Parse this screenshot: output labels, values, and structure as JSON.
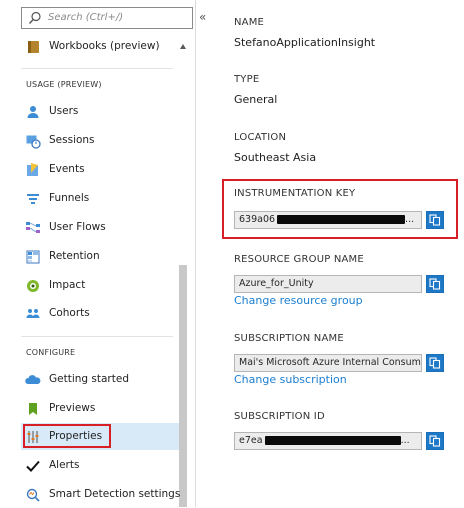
{
  "sidebar": {
    "search_placeholder": "Search (Ctrl+/)",
    "collapse_icon": "«",
    "sections": {
      "usage": "USAGE (PREVIEW)",
      "configure": "CONFIGURE"
    },
    "items": [
      {
        "label": "Workbooks (preview)",
        "icon": "workbook-icon"
      },
      {
        "label": "Users",
        "icon": "user-icon"
      },
      {
        "label": "Sessions",
        "icon": "sessions-icon"
      },
      {
        "label": "Events",
        "icon": "events-icon"
      },
      {
        "label": "Funnels",
        "icon": "funnel-icon"
      },
      {
        "label": "User Flows",
        "icon": "user-flows-icon"
      },
      {
        "label": "Retention",
        "icon": "retention-icon"
      },
      {
        "label": "Impact",
        "icon": "impact-icon"
      },
      {
        "label": "Cohorts",
        "icon": "cohorts-icon"
      },
      {
        "label": "Getting started",
        "icon": "cloud-icon"
      },
      {
        "label": "Previews",
        "icon": "bookmark-icon"
      },
      {
        "label": "Properties",
        "icon": "properties-icon"
      },
      {
        "label": "Alerts",
        "icon": "checkmark-icon"
      },
      {
        "label": "Smart Detection settings",
        "icon": "smart-detection-icon"
      }
    ],
    "selected": "Properties"
  },
  "properties": {
    "name_label": "NAME",
    "name_value": "StefanoApplicationInsight",
    "type_label": "TYPE",
    "type_value": "General",
    "location_label": "LOCATION",
    "location_value": "Southeast Asia",
    "ikey_label": "INSTRUMENTATION KEY",
    "ikey_prefix": "639a06",
    "ikey_suffix": "...",
    "rg_label": "RESOURCE GROUP NAME",
    "rg_value": "Azure_for_Unity",
    "rg_link": "Change resource group",
    "sub_label": "SUBSCRIPTION NAME",
    "sub_value": "Mai's Microsoft Azure Internal Consum...",
    "sub_link": "Change subscription",
    "subid_label": "SUBSCRIPTION ID",
    "subid_prefix": "e7ea",
    "subid_suffix": "..."
  },
  "colors": {
    "accent": "#1e78c8",
    "link": "#1b7ed1",
    "highlight": "#d81f26",
    "selected_bg": "#d8e9f7"
  }
}
